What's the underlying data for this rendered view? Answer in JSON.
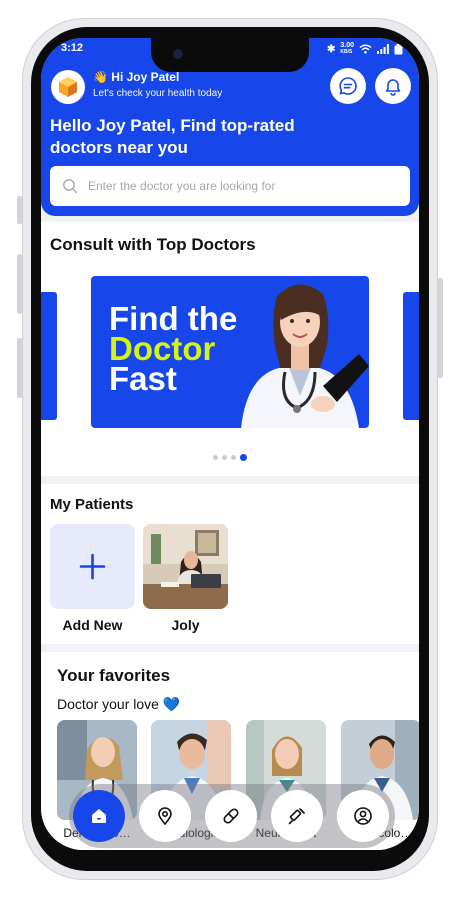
{
  "status_bar": {
    "time": "3:12",
    "speed": "3.00",
    "speed_unit": "KB/S"
  },
  "header": {
    "greeting": "👋 Hi Joy Patel",
    "subtitle": "Let's check your health today",
    "headline": "Hello Joy Patel, Find top-rated doctors near you"
  },
  "search": {
    "placeholder": "Enter the doctor you are looking for"
  },
  "consult": {
    "title": "Consult with Top Doctors",
    "banner_line1": "Find the",
    "banner_line2": "Doctor",
    "banner_line3": "Fast",
    "active_slide": 4,
    "total_slides": 4
  },
  "patients": {
    "title": "My Patients",
    "items": [
      {
        "label": "Add New",
        "icon": "plus-icon"
      },
      {
        "label": "Joly",
        "icon": "patient-photo"
      }
    ]
  },
  "favorites": {
    "title": "Your favorites",
    "subtitle": "Doctor your love",
    "heart": "💙",
    "items": [
      {
        "label": "Dermatolo…"
      },
      {
        "label": "Cardiologist"
      },
      {
        "label": "Neurologist"
      },
      {
        "label": "Gynecolo…"
      }
    ]
  },
  "bottom_nav": {
    "items": [
      {
        "icon": "home-icon",
        "active": true
      },
      {
        "icon": "location-icon",
        "active": false
      },
      {
        "icon": "pill-icon",
        "active": false
      },
      {
        "icon": "syringe-icon",
        "active": false
      },
      {
        "icon": "profile-icon",
        "active": false
      }
    ]
  },
  "colors": {
    "brand": "#1747ea",
    "accent_yellow": "#d4f21c",
    "background": "#f1f2f6"
  }
}
